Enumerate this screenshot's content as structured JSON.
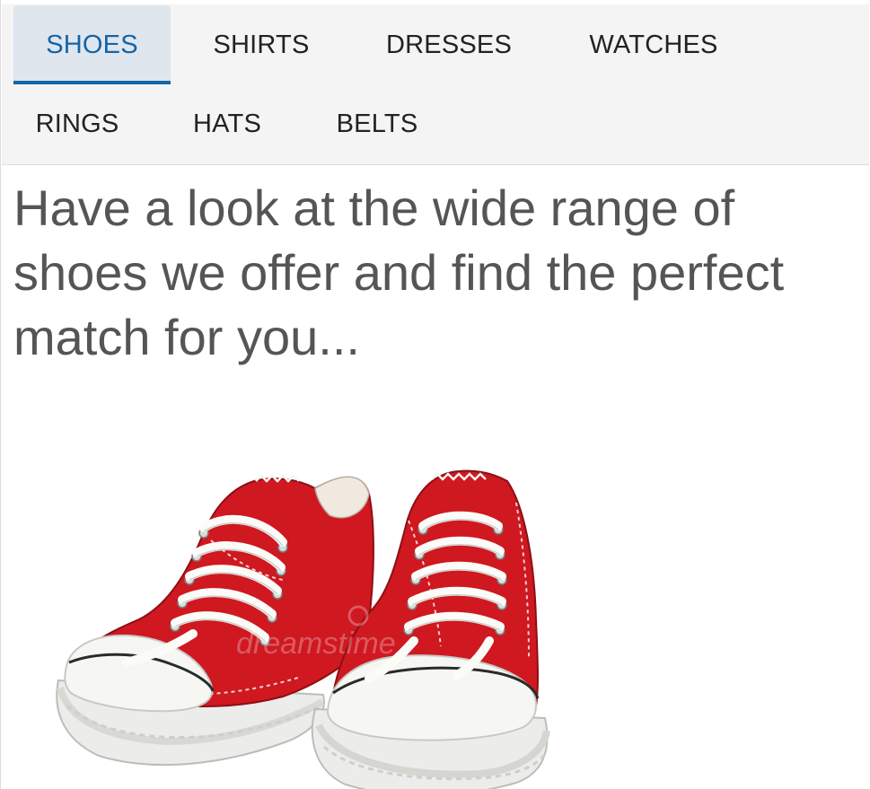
{
  "tabs": [
    {
      "label": "SHOES",
      "active": true
    },
    {
      "label": "SHIRTS",
      "active": false
    },
    {
      "label": "DRESSES",
      "active": false
    },
    {
      "label": "WATCHES",
      "active": false
    },
    {
      "label": "RINGS",
      "active": false
    },
    {
      "label": "HATS",
      "active": false
    },
    {
      "label": "BELTS",
      "active": false
    }
  ],
  "main": {
    "headline": "Have a look at the wide range of shoes we offer and find the perfect match for you...",
    "image": {
      "subject": "pair of red canvas sneakers with white laces and rubber toe caps",
      "watermark": "dreamstime"
    }
  },
  "colors": {
    "accent": "#1565a6",
    "active_tab_bg": "#dfe6ee",
    "tabbar_bg": "#f4f4f4",
    "headline": "#555555",
    "sneaker_red": "#d0141c"
  }
}
